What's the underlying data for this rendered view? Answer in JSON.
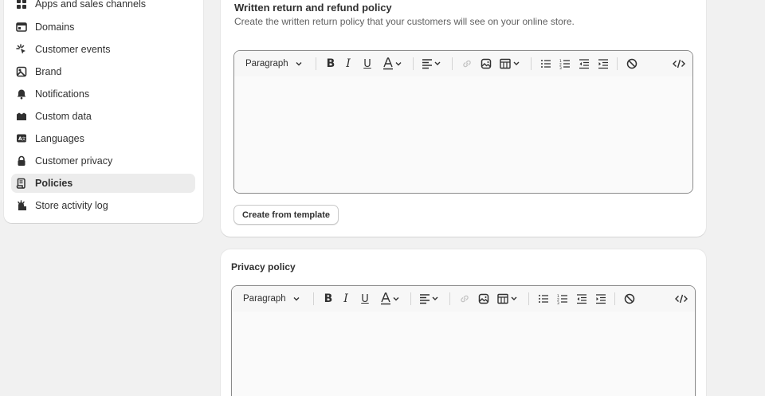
{
  "sidebar": {
    "items": [
      {
        "label": "Apps and sales channels",
        "icon": "apps-icon",
        "active": false
      },
      {
        "label": "Domains",
        "icon": "domains-icon",
        "active": false
      },
      {
        "label": "Customer events",
        "icon": "customer-events-icon",
        "active": false
      },
      {
        "label": "Brand",
        "icon": "brand-icon",
        "active": false
      },
      {
        "label": "Notifications",
        "icon": "bell-icon",
        "active": false
      },
      {
        "label": "Custom data",
        "icon": "custom-data-icon",
        "active": false
      },
      {
        "label": "Languages",
        "icon": "languages-icon",
        "active": false
      },
      {
        "label": "Customer privacy",
        "icon": "lock-icon",
        "active": false
      },
      {
        "label": "Policies",
        "icon": "policies-icon",
        "active": true
      },
      {
        "label": "Store activity log",
        "icon": "activity-log-icon",
        "active": false
      }
    ]
  },
  "refund_policy": {
    "title": "Written return and refund policy",
    "description": "Create the written return policy that your customers will see on your online store.",
    "template_button": "Create from template"
  },
  "privacy_policy": {
    "title": "Privacy policy"
  },
  "editor": {
    "format_select": "Paragraph"
  }
}
